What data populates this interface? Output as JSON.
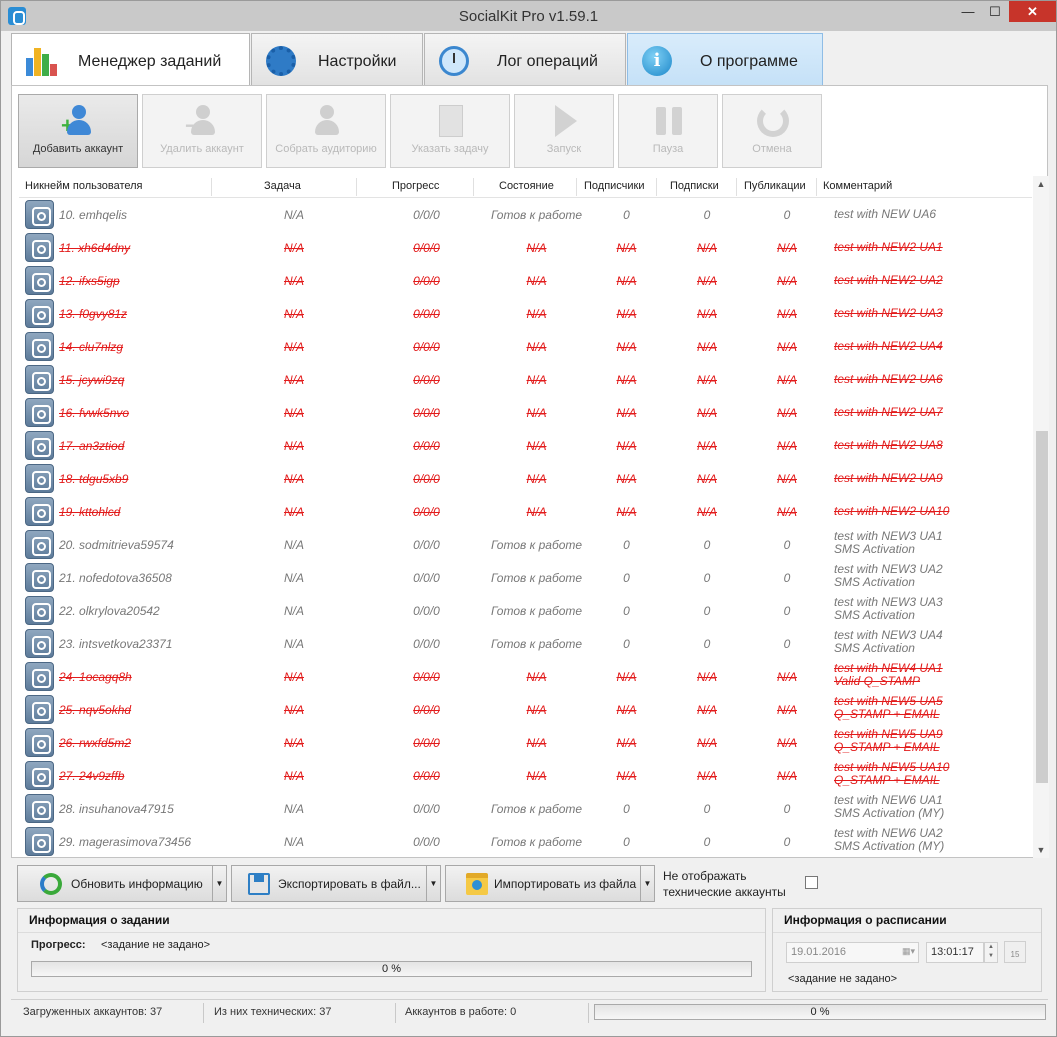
{
  "window": {
    "title": "SocialKit Pro v1.59.1",
    "min": "—",
    "max": "☐",
    "close": "✕"
  },
  "tabs": [
    {
      "label": "Менеджер заданий"
    },
    {
      "label": "Настройки"
    },
    {
      "label": "Лог операций"
    },
    {
      "label": "О программе"
    }
  ],
  "toolbar": {
    "add_account": "Добавить аккаунт",
    "delete_account": "Удалить аккаунт",
    "collect_audience": "Собрать аудиторию",
    "set_task": "Указать задачу",
    "start": "Запуск",
    "pause": "Пауза",
    "cancel": "Отмена"
  },
  "columns": {
    "nickname": "Никнейм пользователя",
    "task": "Задача",
    "progress": "Прогресс",
    "state": "Состояние",
    "subscribers": "Подписчики",
    "subscriptions": "Подписки",
    "publications": "Публикации",
    "comment": "Комментарий"
  },
  "rows": [
    {
      "nick": "10. emhqelis",
      "task": "N/A",
      "progress": "0/0/0",
      "state": "Готов к работе",
      "subs": "0",
      "folw": "0",
      "pubs": "0",
      "comment": "test with NEW UA6",
      "comment2": "",
      "tech": false
    },
    {
      "nick": "11. xh6d4dny",
      "task": "N/A",
      "progress": "0/0/0",
      "state": "N/A",
      "subs": "N/A",
      "folw": "N/A",
      "pubs": "N/A",
      "comment": "test with NEW2 UA1",
      "comment2": "",
      "tech": true
    },
    {
      "nick": "12. ifxs5igp",
      "task": "N/A",
      "progress": "0/0/0",
      "state": "N/A",
      "subs": "N/A",
      "folw": "N/A",
      "pubs": "N/A",
      "comment": "test with NEW2 UA2",
      "comment2": "",
      "tech": true
    },
    {
      "nick": "13. f0gvy81z",
      "task": "N/A",
      "progress": "0/0/0",
      "state": "N/A",
      "subs": "N/A",
      "folw": "N/A",
      "pubs": "N/A",
      "comment": "test with NEW2 UA3",
      "comment2": "",
      "tech": true
    },
    {
      "nick": "14. clu7nlzg",
      "task": "N/A",
      "progress": "0/0/0",
      "state": "N/A",
      "subs": "N/A",
      "folw": "N/A",
      "pubs": "N/A",
      "comment": "test with NEW2 UA4",
      "comment2": "",
      "tech": true
    },
    {
      "nick": "15. jcywi9zq",
      "task": "N/A",
      "progress": "0/0/0",
      "state": "N/A",
      "subs": "N/A",
      "folw": "N/A",
      "pubs": "N/A",
      "comment": "test with NEW2 UA6",
      "comment2": "",
      "tech": true
    },
    {
      "nick": "16. fvwk5nvo",
      "task": "N/A",
      "progress": "0/0/0",
      "state": "N/A",
      "subs": "N/A",
      "folw": "N/A",
      "pubs": "N/A",
      "comment": "test with NEW2 UA7",
      "comment2": "",
      "tech": true
    },
    {
      "nick": "17. an3ztiod",
      "task": "N/A",
      "progress": "0/0/0",
      "state": "N/A",
      "subs": "N/A",
      "folw": "N/A",
      "pubs": "N/A",
      "comment": "test with NEW2 UA8",
      "comment2": "",
      "tech": true
    },
    {
      "nick": "18. tdgu5xb9",
      "task": "N/A",
      "progress": "0/0/0",
      "state": "N/A",
      "subs": "N/A",
      "folw": "N/A",
      "pubs": "N/A",
      "comment": "test with NEW2 UA9",
      "comment2": "",
      "tech": true
    },
    {
      "nick": "19. kttohlcd",
      "task": "N/A",
      "progress": "0/0/0",
      "state": "N/A",
      "subs": "N/A",
      "folw": "N/A",
      "pubs": "N/A",
      "comment": "test with NEW2 UA10",
      "comment2": "",
      "tech": true
    },
    {
      "nick": "20. sodmitrieva59574",
      "task": "N/A",
      "progress": "0/0/0",
      "state": "Готов к работе",
      "subs": "0",
      "folw": "0",
      "pubs": "0",
      "comment": "test with NEW3 UA1",
      "comment2": "SMS Activation",
      "tech": false
    },
    {
      "nick": "21. nofedotova36508",
      "task": "N/A",
      "progress": "0/0/0",
      "state": "Готов к работе",
      "subs": "0",
      "folw": "0",
      "pubs": "0",
      "comment": "test with NEW3 UA2",
      "comment2": "SMS Activation",
      "tech": false
    },
    {
      "nick": "22. olkrylova20542",
      "task": "N/A",
      "progress": "0/0/0",
      "state": "Готов к работе",
      "subs": "0",
      "folw": "0",
      "pubs": "0",
      "comment": "test with NEW3 UA3",
      "comment2": "SMS Activation",
      "tech": false
    },
    {
      "nick": "23. intsvetkova23371",
      "task": "N/A",
      "progress": "0/0/0",
      "state": "Готов к работе",
      "subs": "0",
      "folw": "0",
      "pubs": "0",
      "comment": "test with NEW3 UA4",
      "comment2": "SMS Activation",
      "tech": false
    },
    {
      "nick": "24. 1ocagq8h",
      "task": "N/A",
      "progress": "0/0/0",
      "state": "N/A",
      "subs": "N/A",
      "folw": "N/A",
      "pubs": "N/A",
      "comment": "test with NEW4 UA1",
      "comment2": "Valid Q_STAMP",
      "tech": true
    },
    {
      "nick": "25. nqv5okhd",
      "task": "N/A",
      "progress": "0/0/0",
      "state": "N/A",
      "subs": "N/A",
      "folw": "N/A",
      "pubs": "N/A",
      "comment": "test with NEW5 UA5",
      "comment2": "Q_STAMP + EMAIL",
      "tech": true
    },
    {
      "nick": "26. rwxfd5m2",
      "task": "N/A",
      "progress": "0/0/0",
      "state": "N/A",
      "subs": "N/A",
      "folw": "N/A",
      "pubs": "N/A",
      "comment": "test with NEW5 UA9",
      "comment2": "Q_STAMP + EMAIL",
      "tech": true
    },
    {
      "nick": "27. 24v9zffb",
      "task": "N/A",
      "progress": "0/0/0",
      "state": "N/A",
      "subs": "N/A",
      "folw": "N/A",
      "pubs": "N/A",
      "comment": "test with NEW5 UA10",
      "comment2": "Q_STAMP + EMAIL",
      "tech": true
    },
    {
      "nick": "28. insuhanova47915",
      "task": "N/A",
      "progress": "0/0/0",
      "state": "Готов к работе",
      "subs": "0",
      "folw": "0",
      "pubs": "0",
      "comment": "test with NEW6 UA1",
      "comment2": "SMS Activation (MY)",
      "tech": false
    },
    {
      "nick": "29. magerasimova73456",
      "task": "N/A",
      "progress": "0/0/0",
      "state": "Готов к работе",
      "subs": "0",
      "folw": "0",
      "pubs": "0",
      "comment": "test with NEW6 UA2",
      "comment2": "SMS Activation (MY)",
      "tech": false
    }
  ],
  "bottom": {
    "refresh": "Обновить информацию",
    "export": "Экспортировать в файл...",
    "import": "Импортировать из файла",
    "hide_tech_line1": "Не отображать",
    "hide_tech_line2": "технические аккаунты",
    "hide_tech_checked": false
  },
  "task_info": {
    "title": "Информация о задании",
    "progress_label": "Прогресс:",
    "progress_value": "<задание не задано>",
    "percent_text": "0 %",
    "percent": 0
  },
  "schedule": {
    "title": "Информация о расписании",
    "date": "19.01.2016",
    "time": "13:01:17",
    "calendar_day": "15",
    "status": "<задание не задано>"
  },
  "statusbar": {
    "loaded": "Загруженных аккаунтов: 37",
    "technical": "Из них технических: 37",
    "working": "Аккаунтов в работе: 0",
    "percent_text": "0 %",
    "percent": 0
  },
  "colors": {
    "tech_red": "#e21b1b",
    "normal_gray": "#777777",
    "progress_green": "#5cb85c"
  }
}
